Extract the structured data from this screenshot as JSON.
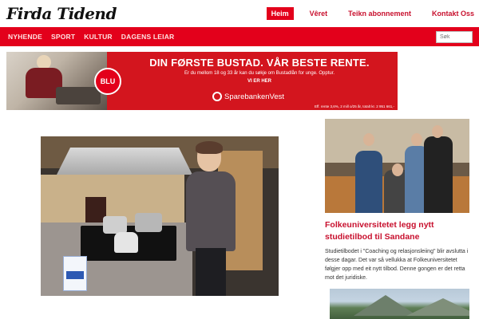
{
  "header": {
    "logo": "Firda Tidend",
    "topnav": [
      "Heim",
      "Vêret",
      "Teikn abonnement",
      "Kontakt Oss"
    ]
  },
  "nav": {
    "categories": [
      "NYHENDE",
      "SPORT",
      "KULTUR",
      "DAGENS LEIAR"
    ],
    "search_placeholder": "Søk"
  },
  "ad": {
    "badge": "BLU",
    "headline": "DIN FØRSTE BUSTAD. VÅR BESTE RENTE.",
    "subline": "Er du mellom 18 og 33 år kan du søkje om Bustadlån for unge. Opptur.",
    "cta": "VI ER HER",
    "brand": "SparebankenVest",
    "fineprint": "Eff. rente 3,6%, 2 mill o/25 år, totalt kr. 2 951 661,-"
  },
  "sidebar": {
    "title": "Folkeuniversitetet legg nytt studietilbod til Sandane",
    "text": "Studietilbodet i \"Coaching og relasjonsleiing\" blir avslutta i desse dagar. Det var så vellukka at Folkeuniversitetet følgjer opp med eit nytt tilbod. Denne gongen er det retta mot det juridiske."
  },
  "colors": {
    "accent": "#e3001b",
    "link": "#c8102e"
  }
}
